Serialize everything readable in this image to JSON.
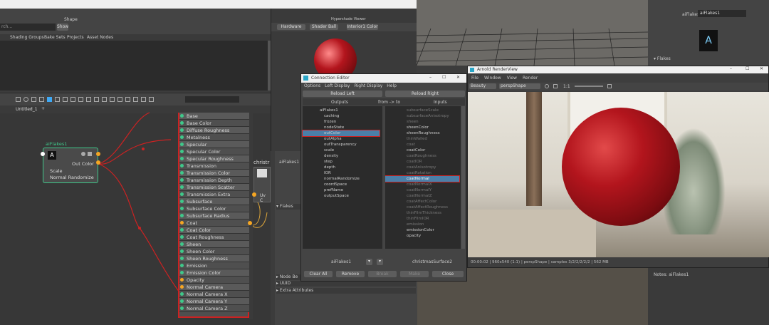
{
  "ne_toolbar": {
    "shape_label": "Shape",
    "show_label": "Show",
    "search_placeholder": "rch...",
    "tabs": [
      "Shading Groups",
      "Bake Sets",
      "Projects",
      "Asset Nodes"
    ]
  },
  "ne_graph": {
    "tab": "Untitled_1",
    "add_tab": "+"
  },
  "small_node": {
    "title": "aiFlakes1",
    "attrs": [
      "Out Color",
      "Scale",
      "Normal Randomize"
    ]
  },
  "big_node_attrs": [
    "Base",
    "Base Color",
    "Diffuse Roughness",
    "Metalness",
    "Specular",
    "Specular Color",
    "Specular Roughness",
    "Transmission",
    "Transmission Color",
    "Transmission Depth",
    "Transmission Scatter",
    "Transmission Extra Roughness",
    "Subsurface",
    "Subsurface Color",
    "Subsurface Radius",
    "Coat",
    "Coat Color",
    "Coat Roughness",
    "Sheen",
    "Sheen Color",
    "Sheen Roughness",
    "Emission",
    "Emission Color",
    "Opacity",
    "Normal Camera",
    "Normal Camera X",
    "Normal Camera Y",
    "Normal Camera Z"
  ],
  "christ_node_label": "christr",
  "christ_node_attr": "Uv C",
  "hypershade_viewer": {
    "title": "Hypershade Viewer",
    "dropdown1": "Hardware",
    "dropdown2": "Shader Ball",
    "dropdown3": "Interior1 Color"
  },
  "attr_editor": {
    "tab": "aiFlakes1",
    "section1": "Flakes",
    "sections": [
      "Node Be",
      "UUID",
      "Extra Attributes"
    ]
  },
  "top_right": {
    "field_label": "aiFlakes:",
    "field_value": "aiFlakes1",
    "section": "Flakes"
  },
  "notes": {
    "label": "Notes: aiFlakes1"
  },
  "ce": {
    "title": "Connection Editor",
    "menus": [
      "Options",
      "Left Display",
      "Right Display",
      "Help"
    ],
    "reload_left": "Reload Left",
    "reload_right": "Reload Right",
    "outputs": "Outputs",
    "from_to": "from -> to",
    "inputs": "Inputs",
    "left_items": [
      "aiFlakes1",
      "caching",
      "frozen",
      "nodeState",
      "outColor",
      "outAlpha",
      "outTransparency",
      "scale",
      "density",
      "step",
      "depth",
      "IOR",
      "normalRandomize",
      "coordSpace",
      "prefName",
      "outputSpace"
    ],
    "right_items": [
      "subsurfaceScale",
      "subsurfaceAnisotropy",
      "sheen",
      "sheenColor",
      "sheenRoughness",
      "thinWalled",
      "coat",
      "coatColor",
      "coatRoughness",
      "coatIOR",
      "coatAnisotropy",
      "coatRotation",
      "coatNormal",
      "coatNormalX",
      "coatNormalY",
      "coatNormalZ",
      "coatAffectColor",
      "coatAffectRoughness",
      "thinFilmThickness",
      "thinFilmIOR",
      "emission",
      "emissionColor",
      "opacity"
    ],
    "left_footer": "aiFlakes1",
    "right_footer": "christmasSurface2",
    "buttons": [
      "Clear All",
      "Remove",
      "Break",
      "Make",
      "Close"
    ]
  },
  "rv": {
    "title": "Arnold RenderView",
    "menus": [
      "File",
      "Window",
      "View",
      "Render"
    ],
    "aov": "Beauty",
    "camera": "perspShape",
    "ratio": "1:1",
    "status": "00:00:02 | 960x540 (1:1) | perspShape | samples 3/2/2/2/2/2 | 562 MB"
  },
  "colors": {
    "accent": "#4b7fa8",
    "node_border": "#cc2222",
    "flakes_node": "#3fc88a",
    "ball": "#b3151d"
  }
}
